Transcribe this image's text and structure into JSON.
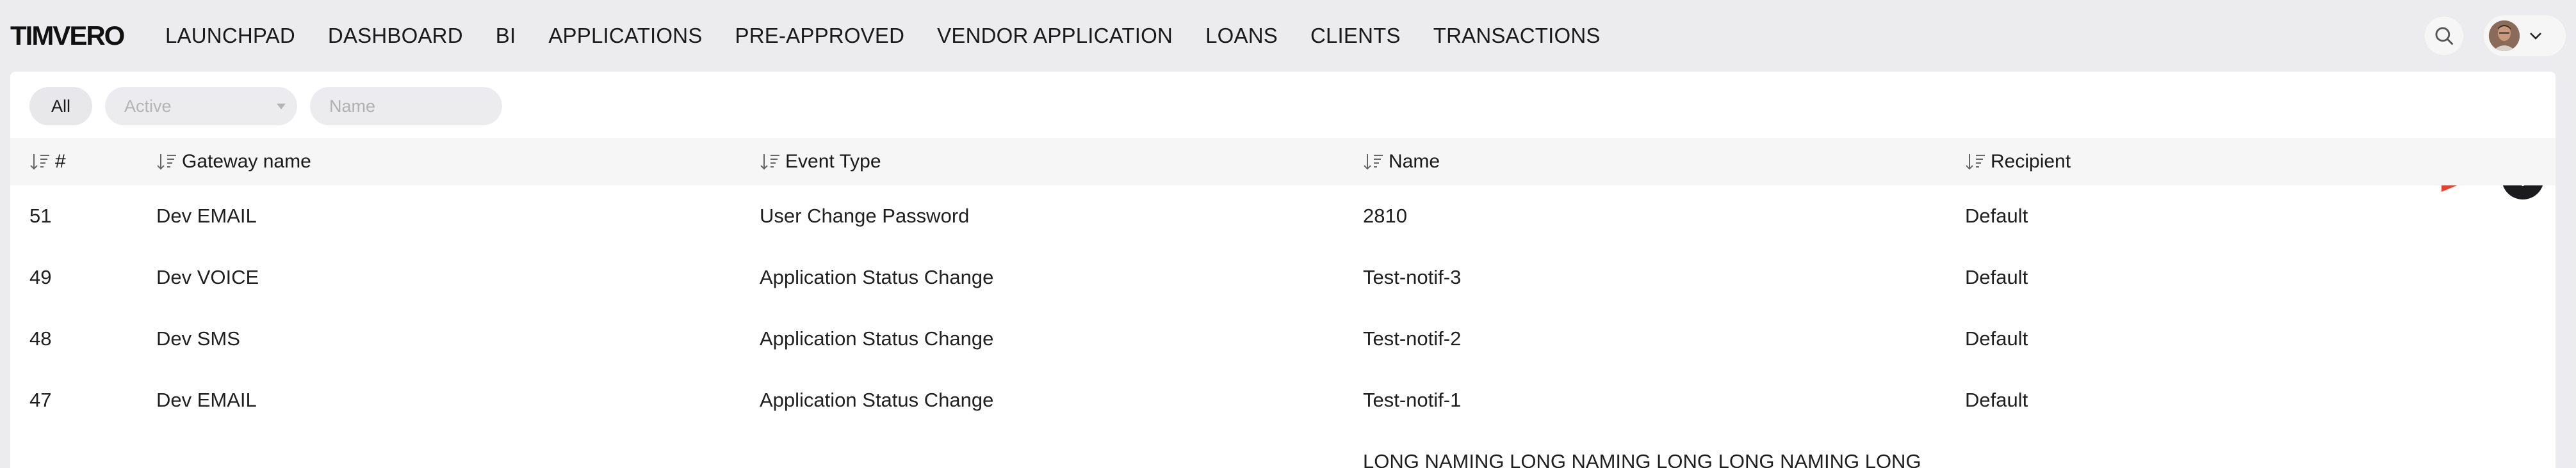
{
  "app": {
    "logo_text": "TIMVERO"
  },
  "nav": {
    "items": [
      "LAUNCHPAD",
      "DASHBOARD",
      "BI",
      "APPLICATIONS",
      "PRE-APPROVED",
      "VENDOR APPLICATION",
      "LOANS",
      "CLIENTS",
      "TRANSACTIONS"
    ]
  },
  "header": {
    "search_icon": "search-icon",
    "user_avatar": "avatar",
    "user_menu_icon": "chevron-down-icon"
  },
  "filters": {
    "all_label": "All",
    "status_select_value": "Active",
    "name_placeholder": "Name"
  },
  "actions": {
    "add_icon": "plus-icon",
    "annotation_arrow_color": "#e8402a"
  },
  "table": {
    "columns": [
      "#",
      "Gateway name",
      "Event Type",
      "Name",
      "Recipient"
    ],
    "rows": [
      [
        "51",
        "Dev EMAIL",
        "User Change Password",
        "2810",
        "Default"
      ],
      [
        "49",
        "Dev VOICE",
        "Application Status Change",
        "Test-notif-3",
        "Default"
      ],
      [
        "48",
        "Dev SMS",
        "Application Status Change",
        "Test-notif-2",
        "Default"
      ],
      [
        "47",
        "Dev EMAIL",
        "Application Status Change",
        "Test-notif-1",
        "Default"
      ],
      [
        "",
        "",
        "",
        "LONG NAMING LONG NAMING LONG LONG NAMING LONG",
        ""
      ]
    ]
  },
  "colors": {
    "accent_dark": "#1b1b1d",
    "background": "#ececee",
    "arrow": "#e8402a"
  }
}
